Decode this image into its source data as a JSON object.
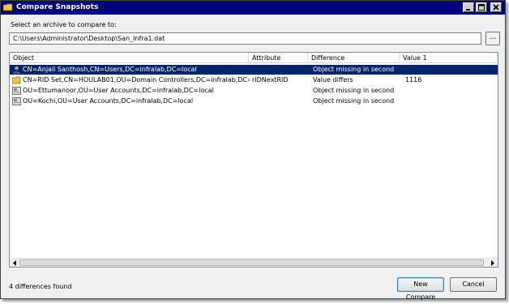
{
  "window": {
    "title": "Compare Snapshots"
  },
  "archive": {
    "label": "Select an archive to compare to:",
    "path": "C:\\Users\\Administrator\\Desktop\\San_Infra1.dat",
    "browse_label": "..."
  },
  "list": {
    "columns": [
      "Object",
      "Attribute",
      "Difference",
      "Value 1"
    ],
    "rows": [
      {
        "icon": "user-icon",
        "object": "CN=Anjali Santhosh,CN=Users,DC=infralab,DC=local",
        "attribute": "",
        "difference": "Object missing in second",
        "value1": "",
        "selected": true
      },
      {
        "icon": "folder-icon",
        "object": "CN=RID Set,CN=HOULAB01,OU=Domain Controllers,DC=infralab,DC=local",
        "attribute": "rIDNextRID",
        "difference": "Value differs",
        "value1": "1116",
        "selected": false
      },
      {
        "icon": "ou-icon",
        "object": "OU=Ettumanoor,OU=User Accounts,DC=infralab,DC=local",
        "attribute": "",
        "difference": "Object missing in second",
        "value1": "",
        "selected": false
      },
      {
        "icon": "ou-icon",
        "object": "OU=Kochi,OU=User Accounts,DC=infralab,DC=local",
        "attribute": "",
        "difference": "Object missing in second",
        "value1": "",
        "selected": false
      }
    ]
  },
  "status": "4 differences found",
  "buttons": {
    "new_compare": "New Compare",
    "cancel": "Cancel"
  },
  "colors": {
    "titlebar": "#000080",
    "selection": "#0a246a"
  }
}
